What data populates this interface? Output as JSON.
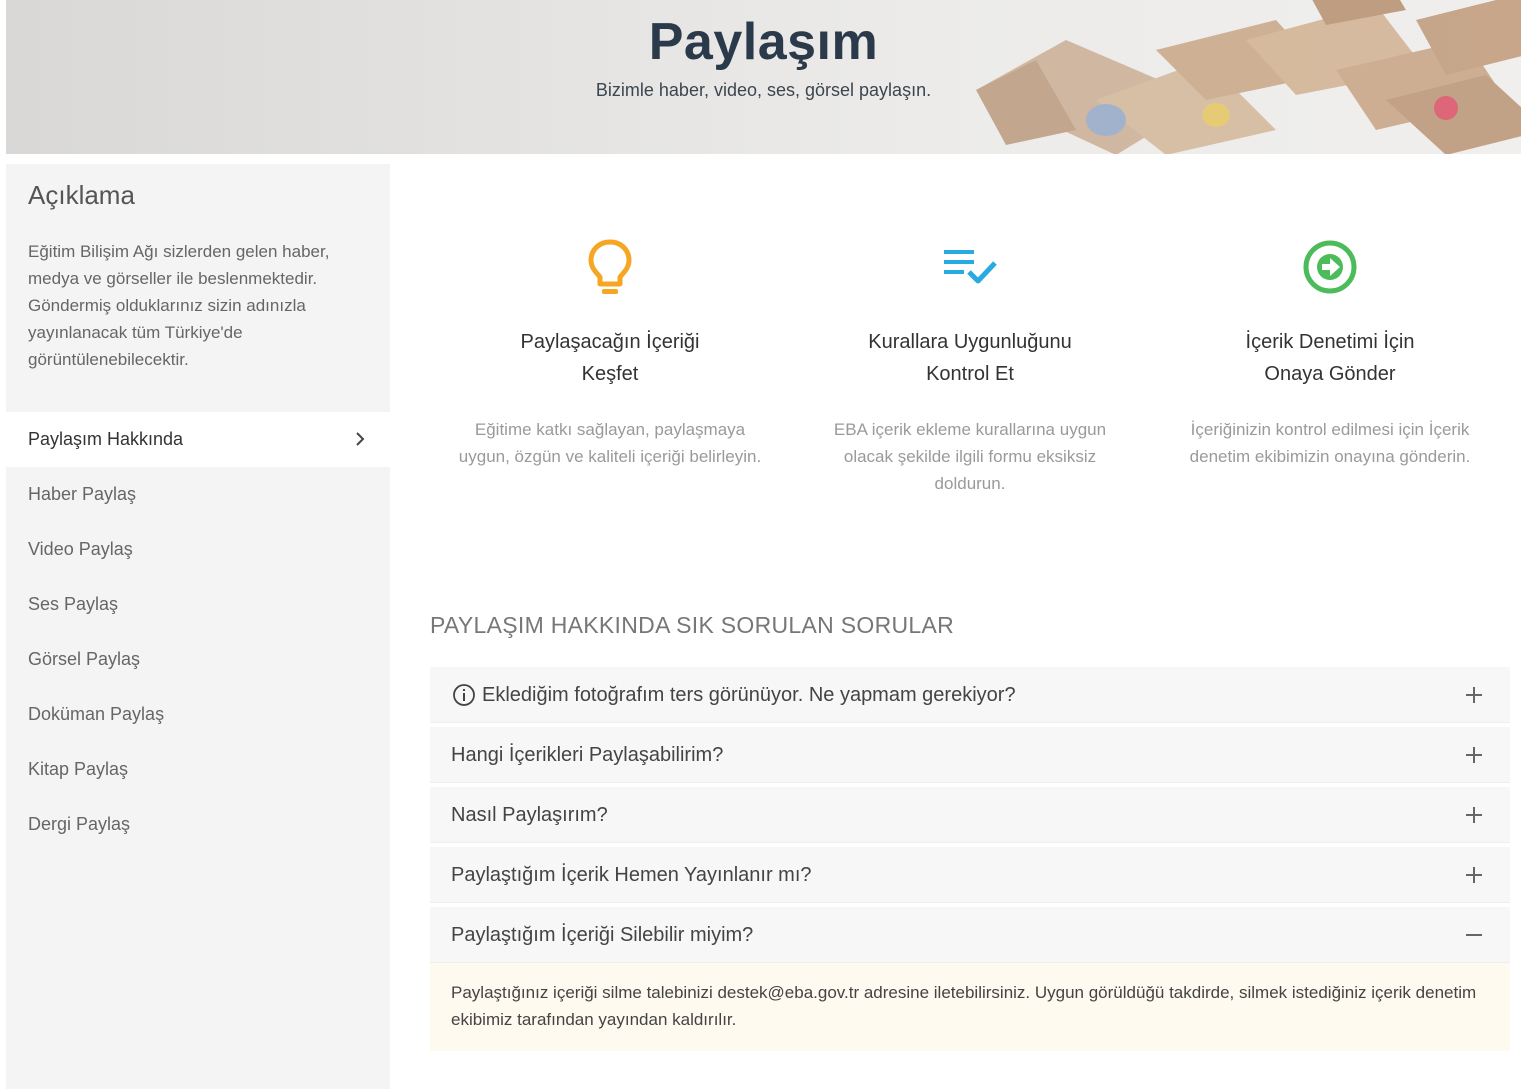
{
  "banner": {
    "title": "Paylaşım",
    "subtitle": "Bizimle haber, video, ses, görsel paylaşın."
  },
  "sidebar": {
    "heading": "Açıklama",
    "description": "Eğitim Bilişim Ağı sizlerden gelen haber, medya ve görseller ile beslenmektedir. Göndermiş olduklarınız sizin adınızla yayınlanacak tüm Türkiye'de görüntülenebilecektir.",
    "items": [
      {
        "label": "Paylaşım Hakkında",
        "active": true
      },
      {
        "label": "Haber Paylaş"
      },
      {
        "label": "Video Paylaş"
      },
      {
        "label": "Ses Paylaş"
      },
      {
        "label": "Görsel Paylaş"
      },
      {
        "label": "Doküman Paylaş"
      },
      {
        "label": "Kitap Paylaş"
      },
      {
        "label": "Dergi Paylaş"
      }
    ]
  },
  "steps": [
    {
      "icon": "lightbulb-icon",
      "color": "#f5a623",
      "title_line1": "Paylaşacağın İçeriği",
      "title_line2": "Keşfet",
      "desc": "Eğitime katkı sağlayan, paylaşmaya uygun, özgün ve kaliteli içeriği belirleyin."
    },
    {
      "icon": "checklist-icon",
      "color": "#29abe2",
      "title_line1": "Kurallara Uygunluğunu",
      "title_line2": "Kontrol Et",
      "desc": "EBA içerik ekleme kurallarına uygun olacak şekilde ilgili formu eksiksiz doldurun."
    },
    {
      "icon": "arrow-circle-right-icon",
      "color": "#4cbb5a",
      "title_line1": "İçerik Denetimi İçin",
      "title_line2": "Onaya Gönder",
      "desc": "İçeriğinizin kontrol edilmesi için İçerik denetim ekibimizin onayına gönderin."
    }
  ],
  "faq": {
    "heading": "PAYLAŞIM HAKKINDA SIK SORULAN SORULAR",
    "items": [
      {
        "question": "Eklediğim fotoğrafım ters görünüyor. Ne yapmam gerekiyor?",
        "expanded": false,
        "icon": "info-icon"
      },
      {
        "question": "Hangi İçerikleri Paylaşabilirim?",
        "expanded": false
      },
      {
        "question": "Nasıl Paylaşırım?",
        "expanded": false
      },
      {
        "question": "Paylaştığım İçerik Hemen Yayınlanır mı?",
        "expanded": false
      },
      {
        "question": "Paylaştığım İçeriği Silebilir miyim?",
        "expanded": true
      }
    ],
    "answer": "Paylaştığınız içeriği silme talebinizi destek@eba.gov.tr adresine iletebilirsiniz. Uygun görüldüğü takdirde, silmek istediğiniz içerik denetim ekibimiz tarafından yayından kaldırılır."
  }
}
